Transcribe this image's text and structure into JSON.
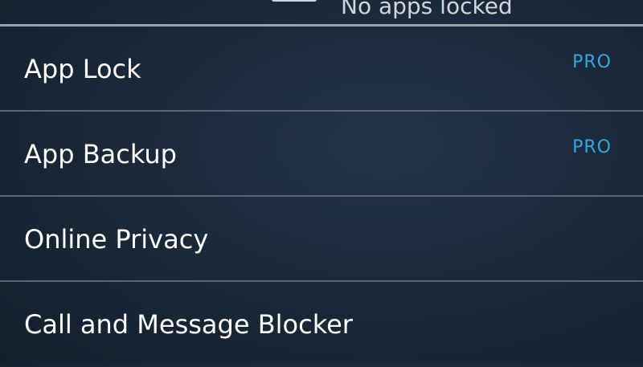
{
  "header": {
    "status_text": "No apps locked"
  },
  "menu": {
    "items": [
      {
        "label": "App Lock",
        "badge": "PRO"
      },
      {
        "label": "App Backup",
        "badge": "PRO"
      },
      {
        "label": "Online Privacy",
        "badge": ""
      },
      {
        "label": "Call and Message Blocker",
        "badge": ""
      }
    ]
  },
  "colors": {
    "badge": "#33a8de",
    "divider": "#5c6672",
    "background": "#182636"
  },
  "icons": {
    "header_icon": "lock-icon"
  }
}
